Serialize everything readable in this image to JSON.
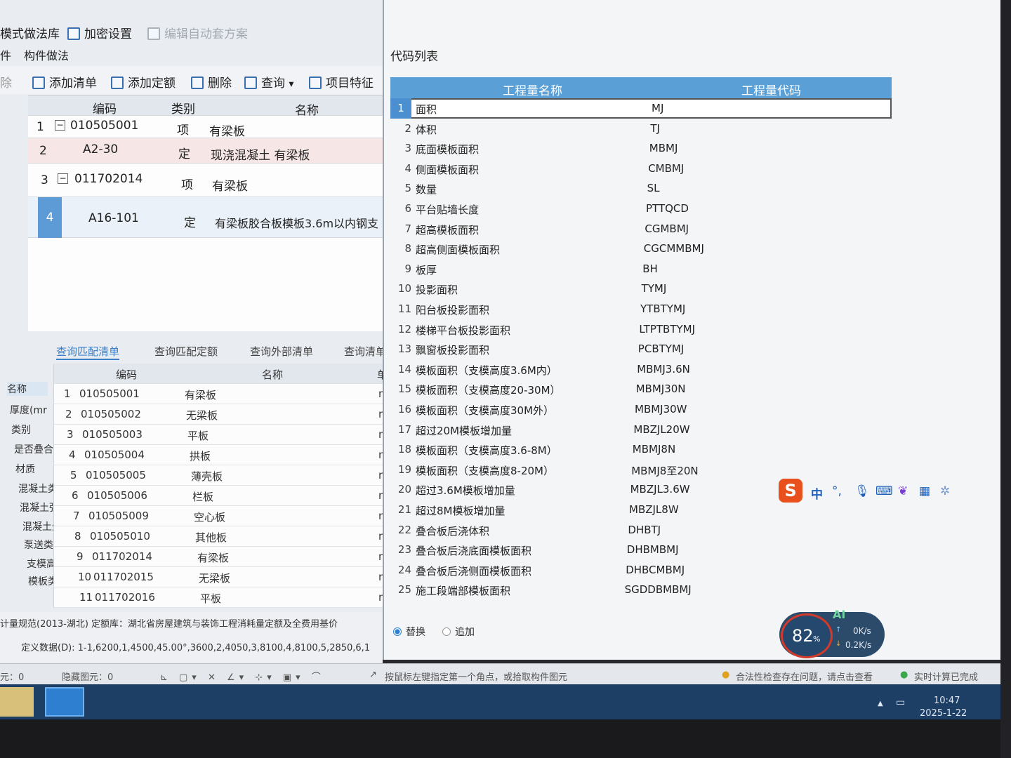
{
  "menu": {
    "items": [
      "模式做法库",
      "加密设置",
      "编辑自动套方案"
    ]
  },
  "subtabs": {
    "left": "件",
    "active": "构件做法"
  },
  "toolbar": {
    "delete_partial": "除",
    "add_list": "添加清单",
    "add_quota": "添加定额",
    "delete": "删除",
    "query": "查询",
    "features": "项目特征"
  },
  "grid1": {
    "headers": {
      "code": "编码",
      "type": "类别",
      "name": "名称"
    },
    "rows": [
      {
        "num": "1",
        "code": "010505001",
        "type": "项",
        "name": "有梁板"
      },
      {
        "num": "2",
        "code": "A2-30",
        "type": "定",
        "name": "现浇混凝土 有梁板"
      },
      {
        "num": "3",
        "code": "011702014",
        "type": "项",
        "name": "有梁板"
      },
      {
        "num": "4",
        "code": "A16-101",
        "type": "定",
        "name": "有梁板胶合板模板3.6m以内钢支"
      }
    ]
  },
  "bottom_tabs": [
    "查询匹配清单",
    "查询匹配定额",
    "查询外部清单",
    "查询清单"
  ],
  "props": [
    "名称",
    "厚度(mr",
    "类别",
    "是否叠合",
    "材质",
    "混凝土类",
    "混凝土强",
    "混凝土外",
    "泵送类型",
    "支模高度",
    "模板类型"
  ],
  "grid2": {
    "headers": {
      "code": "编码",
      "name": "名称",
      "unit": "单"
    },
    "rows": [
      {
        "num": "1",
        "code": "010505001",
        "name": "有梁板",
        "unit": "m"
      },
      {
        "num": "2",
        "code": "010505002",
        "name": "无梁板",
        "unit": "m"
      },
      {
        "num": "3",
        "code": "010505003",
        "name": "平板",
        "unit": "m"
      },
      {
        "num": "4",
        "code": "010505004",
        "name": "拱板",
        "unit": "m"
      },
      {
        "num": "5",
        "code": "010505005",
        "name": "薄壳板",
        "unit": "m"
      },
      {
        "num": "6",
        "code": "010505006",
        "name": "栏板",
        "unit": "m"
      },
      {
        "num": "7",
        "code": "010505009",
        "name": "空心板",
        "unit": "m"
      },
      {
        "num": "8",
        "code": "010505010",
        "name": "其他板",
        "unit": "m"
      },
      {
        "num": "9",
        "code": "011702014",
        "name": "有梁板",
        "unit": "m"
      },
      {
        "num": "10",
        "code": "011702015",
        "name": "无梁板",
        "unit": "m"
      },
      {
        "num": "11",
        "code": "011702016",
        "name": "平板",
        "unit": "m"
      }
    ]
  },
  "info": {
    "line1": "计量规范(2013-湖北)  定额库：湖北省房屋建筑与装饰工程消耗量定额及全费用基价",
    "line2": "定义数据(D):  1-1,6200,1,4500,45.00°,3600,2,4050,3,8100,4,8100,5,2850,6,1"
  },
  "code_list": {
    "title": "代码列表",
    "headers": {
      "name": "工程量名称",
      "code": "工程量代码"
    },
    "rows": [
      {
        "num": "1",
        "name": "面积",
        "code": "MJ"
      },
      {
        "num": "2",
        "name": "体积",
        "code": "TJ"
      },
      {
        "num": "3",
        "name": "底面模板面积",
        "code": "MBMJ"
      },
      {
        "num": "4",
        "name": "侧面模板面积",
        "code": "CMBMJ"
      },
      {
        "num": "5",
        "name": "数量",
        "code": "SL"
      },
      {
        "num": "6",
        "name": "平台贴墙长度",
        "code": "PTTQCD"
      },
      {
        "num": "7",
        "name": "超高模板面积",
        "code": "CGMBMJ"
      },
      {
        "num": "8",
        "name": "超高侧面模板面积",
        "code": "CGCMMBMJ"
      },
      {
        "num": "9",
        "name": "板厚",
        "code": "BH"
      },
      {
        "num": "10",
        "name": "投影面积",
        "code": "TYMJ"
      },
      {
        "num": "11",
        "name": "阳台板投影面积",
        "code": "YTBTYMJ"
      },
      {
        "num": "12",
        "name": "楼梯平台板投影面积",
        "code": "LTPTBTYMJ"
      },
      {
        "num": "13",
        "name": "飘窗板投影面积",
        "code": "PCBTYMJ"
      },
      {
        "num": "14",
        "name": "模板面积（支模高度3.6M内）",
        "code": "MBMJ3.6N"
      },
      {
        "num": "15",
        "name": "模板面积（支模高度20-30M）",
        "code": "MBMJ30N"
      },
      {
        "num": "16",
        "name": "模板面积（支模高度30M外）",
        "code": "MBMJ30W"
      },
      {
        "num": "17",
        "name": "超过20M模板增加量",
        "code": "MBZJL20W"
      },
      {
        "num": "18",
        "name": "模板面积（支模高度3.6-8M）",
        "code": "MBMJ8N"
      },
      {
        "num": "19",
        "name": "模板面积（支模高度8-20M）",
        "code": "MBMJ8至20N"
      },
      {
        "num": "20",
        "name": "超过3.6M模板增加量",
        "code": "MBZJL3.6W"
      },
      {
        "num": "21",
        "name": "超过8M模板增加量",
        "code": "MBZJL8W"
      },
      {
        "num": "22",
        "name": "叠合板后浇体积",
        "code": "DHBTJ"
      },
      {
        "num": "23",
        "name": "叠合板后浇底面模板面积",
        "code": "DHBMBMJ"
      },
      {
        "num": "24",
        "name": "叠合板后浇侧面模板面积",
        "code": "DHBCMBMJ"
      },
      {
        "num": "25",
        "name": "施工段端部模板面积",
        "code": "SGDDBMBMJ"
      }
    ]
  },
  "radios": {
    "replace": "替换",
    "append": "追加"
  },
  "status": {
    "elements": "元：0",
    "hidden": "隐藏图元：0",
    "hint": "按鼠标左键指定第一个角点，或拾取构件图元",
    "warning": "合法性检查存在问题，请点击查看",
    "done": "实时计算已完成"
  },
  "ime": {
    "logo": "S",
    "mode": "中"
  },
  "speed": {
    "percent": "82",
    "percent_unit": "%",
    "up": "0K/s",
    "down": "0.2K/s",
    "ai": "AI"
  },
  "clock": {
    "time": "10:47",
    "date": "2025-1-22"
  },
  "colors": {
    "header_blue": "#5a9fd6",
    "selected_blue": "#4c8fd0",
    "taskbar": "#1d3f66"
  }
}
